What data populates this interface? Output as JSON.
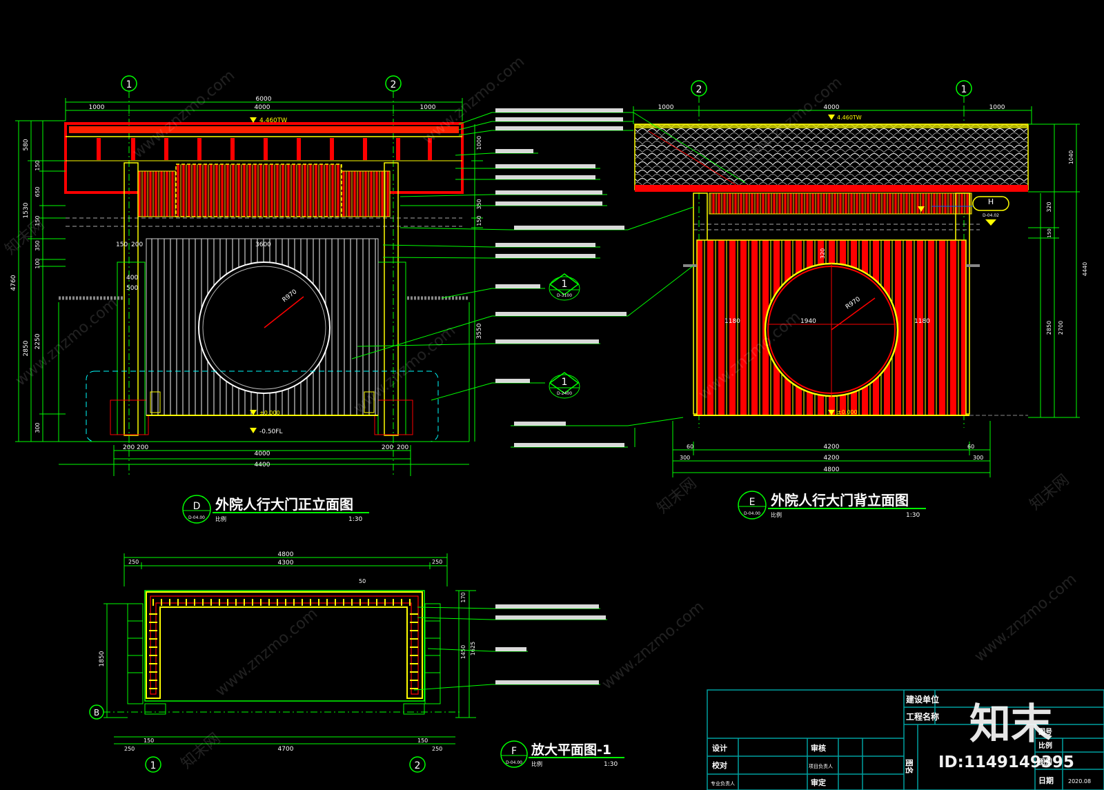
{
  "colors": {
    "background": "#000000",
    "green": "#00ff00",
    "red": "#ff0000",
    "yellow": "#ffff00",
    "white": "#ffffff",
    "cyan": "#00ffff",
    "grey": "#8a8a8a",
    "titleblock": "#00a0a0"
  },
  "front_elevation": {
    "grid_left": "1",
    "grid_right": "2",
    "dim_top_total": "6000",
    "dim_top_left": "1000",
    "dim_top_mid": "4000",
    "dim_top_right": "1000",
    "level_top": "4.460TW",
    "level_floor": "±0.000",
    "level_bottom": "-0.50FL",
    "radius": "R970",
    "dim_bottom_a": "200",
    "dim_bottom_b": "200",
    "dim_bottom_mid": "4000",
    "dim_bottom_c": "200",
    "dim_bottom_d": "200",
    "dim_bottom_total": "4400",
    "dim_inner": "3600",
    "dim_post_a": "400",
    "dim_post_b": "500",
    "dim_post_c": "150",
    "dim_post_d": "200",
    "dim_left_1": "580",
    "dim_left_2": "150",
    "dim_left_3": "650",
    "dim_left_4": "150",
    "dim_left_5": "350",
    "dim_left_6": "100",
    "dim_left_7": "2250",
    "dim_left_8": "300",
    "dim_left_total_a": "1530",
    "dim_left_total_b": "2850",
    "dim_left_total": "4760",
    "dim_right_1": "1000",
    "dim_right_2": "350",
    "dim_right_3": "150",
    "dim_right_4": "3550",
    "marker_letter": "D",
    "marker_sheet": "D-04.00",
    "title": "外院人行大门正立面图",
    "subtitle": "比例",
    "scale": "1:30"
  },
  "back_elevation": {
    "grid_left": "2",
    "grid_right": "1",
    "dim_top_left": "1000",
    "dim_top_mid": "4000",
    "dim_top_right": "1000",
    "level_top": "4.460TW",
    "level_floor": "±0.000",
    "radius": "R970",
    "dim_circle": "1940",
    "dim_side_left": "1180",
    "dim_side_right": "1180",
    "dim_circle_top": "320",
    "dim_bottom_a": "300",
    "dim_bottom_b": "60",
    "dim_bottom_mid": "4200",
    "dim_bottom_c": "60",
    "dim_bottom_d": "300",
    "dim_bottom_mid2": "4200",
    "dim_bottom_total": "4800",
    "dim_right_1": "1040",
    "dim_right_2": "320",
    "dim_right_3": "2850",
    "dim_right_4": "2700",
    "dim_right_total": "4440",
    "dim_right_small": "150",
    "detail_letter": "H",
    "detail_sheet": "D-04.02",
    "marker_letter": "E",
    "marker_sheet": "D-04.00",
    "title": "外院人行大门背立面图",
    "subtitle": "比例",
    "scale": "1:30"
  },
  "plan": {
    "dim_top_total": "4800",
    "dim_top_mid": "4300",
    "dim_top_left": "250",
    "dim_top_right": "250",
    "dim_small_a": "50",
    "dim_left": "1850",
    "dim_right_a": "1450",
    "dim_right_b": "1625",
    "dim_right_c": "170",
    "dim_bottom_mid": "4700",
    "dim_bottom_a": "150",
    "dim_bottom_b": "150",
    "dim_bottom_c": "250",
    "dim_bottom_d": "250",
    "grid_a": "1",
    "grid_b": "2",
    "grid_c": "B",
    "marker_letter": "F",
    "marker_sheet": "D-04.00",
    "title": "放大平面图-1",
    "subtitle": "比例",
    "scale": "1:30"
  },
  "callouts": {
    "section_1_num": "1",
    "section_1_sheet": "D-3100",
    "section_2_num": "1",
    "section_2_sheet": "D-2400"
  },
  "watermark": {
    "site": "www.znzmo.com",
    "brand": "知末网",
    "logo": "知末",
    "id": "ID:1149149395"
  },
  "title_block": {
    "unit_label": "建设单位",
    "project_label": "工程名称",
    "design": "设计",
    "review": "审核",
    "check": "校对",
    "leader": "项目负责人",
    "head": "专业负责人",
    "approve": "审定",
    "drawing_name": "图名",
    "drawing_no": "图号",
    "scale": "比例",
    "sheet": "图别",
    "date": "日期",
    "date_value": "2020.08"
  }
}
